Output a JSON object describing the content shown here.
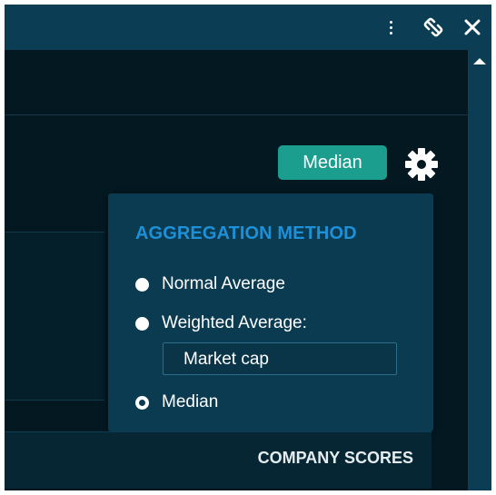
{
  "titlebar": {
    "icons": [
      "more-vertical-icon",
      "unlink-icon",
      "close-icon"
    ]
  },
  "badge": {
    "label": "Median",
    "color": "#1b9e8e"
  },
  "popup": {
    "title": "AGGREGATION METHOD",
    "options": [
      {
        "label": "Normal Average",
        "selected": false
      },
      {
        "label": "Weighted Average:",
        "selected": false
      },
      {
        "label": "Median",
        "selected": true
      }
    ],
    "weight_field_value": "Market cap"
  },
  "bottom": {
    "label": "COMPANY SCORES"
  },
  "colors": {
    "titlebar": "#0b3e55",
    "background": "#031821",
    "popup": "#0b3b51",
    "accent_title": "#1e90d8"
  }
}
